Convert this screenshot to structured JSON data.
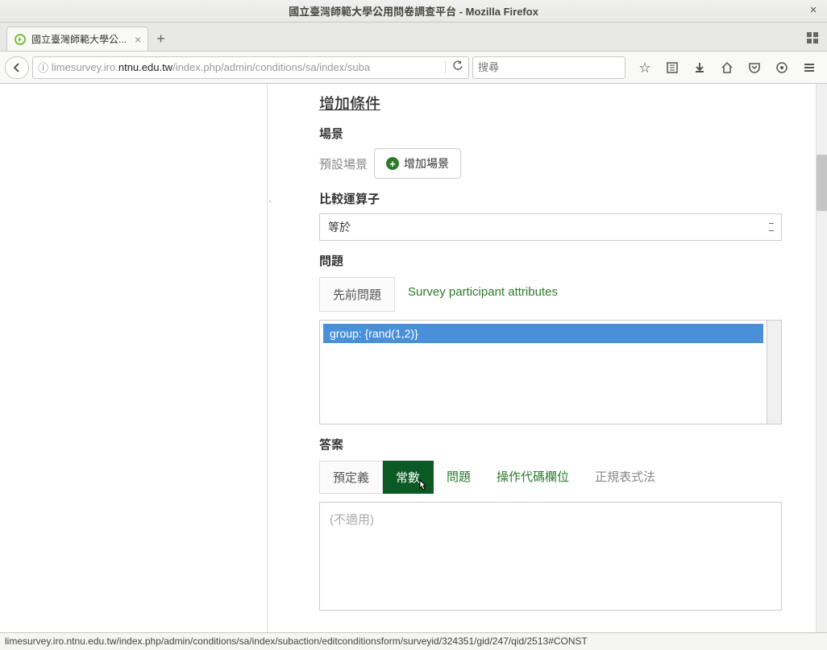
{
  "window": {
    "title": "國立臺灣師範大學公用問卷調查平台 - Mozilla Firefox"
  },
  "tab": {
    "title": "國立臺灣師範大學公..."
  },
  "url": {
    "prefix": "limesurvey.iro.",
    "domain": "ntnu.edu.tw",
    "path": "/index.php/admin/conditions/sa/index/suba"
  },
  "search": {
    "placeholder": "搜尋"
  },
  "page": {
    "add_condition": "增加條件",
    "scene_label": "場景",
    "default_scene": "預設場景",
    "add_scene": "增加場景",
    "operator_label": "比較運算子",
    "operator_value": "等於",
    "question_label": "問題",
    "q_tab_prev": "先前問題",
    "q_tab_attr": "Survey participant attributes",
    "q_list_item": "group: {rand(1,2)}",
    "answer_label": "答案",
    "a_tab_predef": "預定義",
    "a_tab_const": "常數",
    "a_tab_question": "問題",
    "a_tab_tokenfield": "操作代碼欄位",
    "a_tab_regex": "正規表式法",
    "a_placeholder": "(不適用)"
  },
  "status": "limesurvey.iro.ntnu.edu.tw/index.php/admin/conditions/sa/index/subaction/editconditionsform/surveyid/324351/gid/247/qid/2513#CONST"
}
